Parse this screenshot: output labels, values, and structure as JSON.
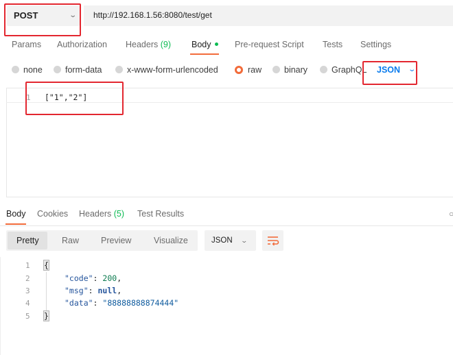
{
  "request": {
    "method": "POST",
    "url": "http://192.168.1.56:8080/test/get"
  },
  "request_tabs": {
    "params": "Params",
    "authorization": "Authorization",
    "headers": "Headers",
    "headers_count": "(9)",
    "body": "Body",
    "pre_request": "Pre-request Script",
    "tests": "Tests",
    "settings": "Settings"
  },
  "body_types": {
    "none": "none",
    "form_data": "form-data",
    "urlencoded": "x-www-form-urlencoded",
    "raw": "raw",
    "binary": "binary",
    "graphql": "GraphQL",
    "language": "JSON",
    "selected": "raw"
  },
  "request_body": {
    "line_number": "1",
    "text": "[\"1\",\"2\"]"
  },
  "response_tabs": {
    "body": "Body",
    "cookies": "Cookies",
    "headers": "Headers",
    "headers_count": "(5)",
    "test_results": "Test Results"
  },
  "response_toolbar": {
    "pretty": "Pretty",
    "raw": "Raw",
    "preview": "Preview",
    "visualize": "Visualize",
    "format": "JSON",
    "wrap_icon": "text-wrap-icon"
  },
  "response_body": {
    "lines": [
      "1",
      "2",
      "3",
      "4",
      "5"
    ],
    "open_brace": "{",
    "close_brace": "}",
    "code_key": "\"code\"",
    "code_value": "200",
    "msg_key": "\"msg\"",
    "msg_value": "null",
    "data_key": "\"data\"",
    "data_value": "\"88888888874444\""
  },
  "colors": {
    "accent": "#f26b3a",
    "highlight_box": "#e3262f",
    "link_blue": "#097bed",
    "status_green": "#0cbb52"
  }
}
